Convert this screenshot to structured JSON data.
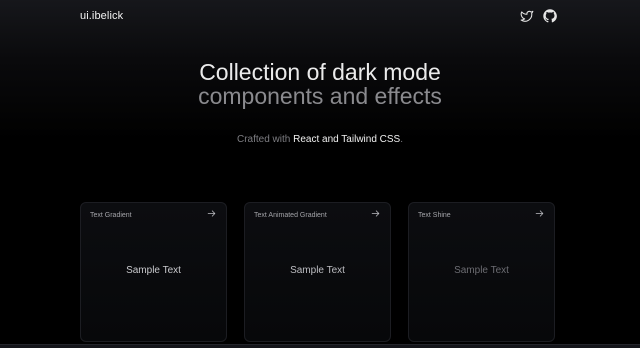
{
  "header": {
    "logo": "ui.ibelick",
    "icons": [
      "twitter-icon",
      "github-icon"
    ]
  },
  "hero": {
    "line1": "Collection of dark mode",
    "line2": "components and effects"
  },
  "subline": {
    "prefix": "Crafted with ",
    "highlight": "React and Tailwind CSS",
    "suffix": "."
  },
  "cards": [
    {
      "title": "Text Gradient",
      "sample": "Sample Text"
    },
    {
      "title": "Text Animated Gradient",
      "sample": "Sample Text"
    },
    {
      "title": "Text Shine",
      "sample": "Sample Text"
    }
  ],
  "colors": {
    "background": "#000000",
    "heading_primary": "#ebebeb",
    "heading_secondary": "#8a8a8e",
    "card_border": "#1c1d22"
  }
}
